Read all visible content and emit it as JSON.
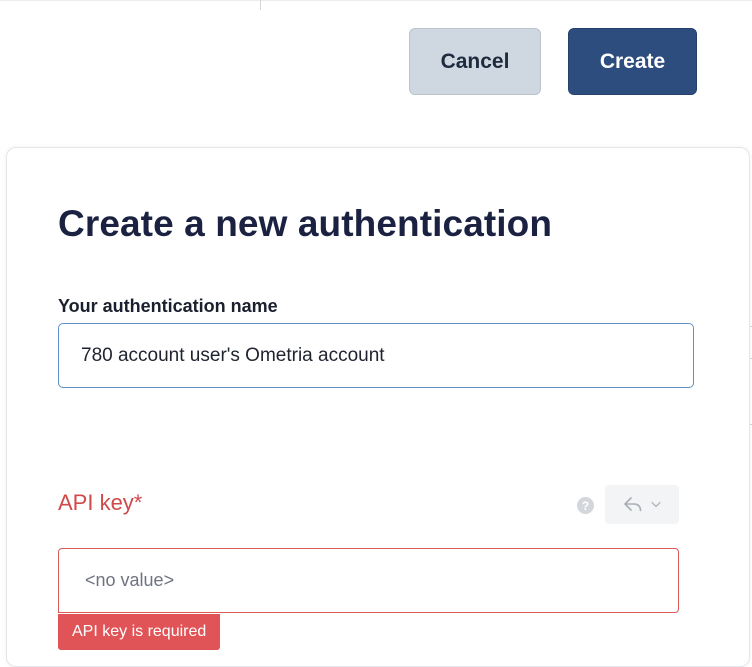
{
  "header": {
    "cancel_label": "Cancel",
    "create_label": "Create"
  },
  "dialog": {
    "title": "Create a new authentication",
    "name_field": {
      "label": "Your authentication name",
      "value": "780 account user's Ometria account"
    },
    "api_key_field": {
      "label": "API key*",
      "value": "",
      "placeholder": "<no value>",
      "error": "API key is required"
    },
    "icons": {
      "help": "help-icon",
      "reset": "undo-icon",
      "dropdown": "chevron-down-icon"
    }
  },
  "colors": {
    "primary": "#2d4d7e",
    "secondary": "#cfd8e1",
    "error": "#e05457",
    "title": "#1b2140",
    "focus_border": "#5b8fc6"
  }
}
